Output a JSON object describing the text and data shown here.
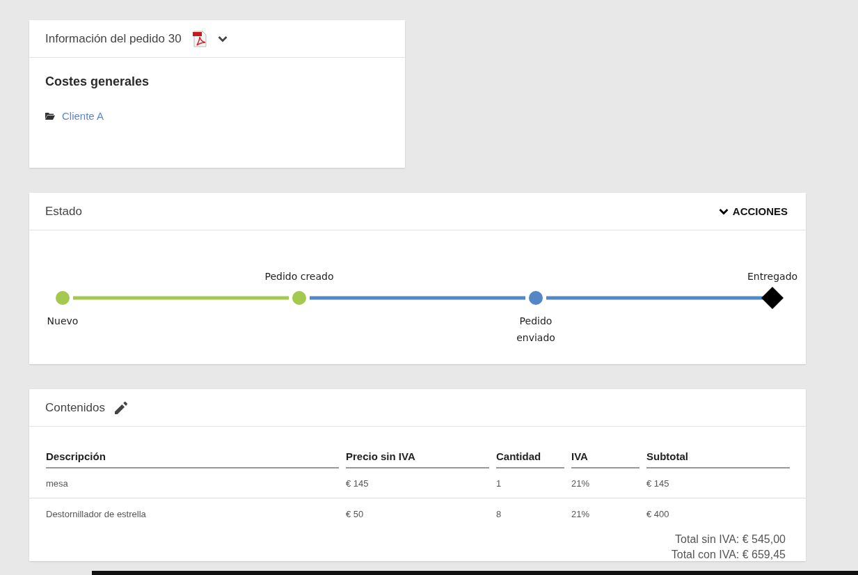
{
  "order_card": {
    "title": "Información del pedido 30",
    "section_title": "Costes generales",
    "client_link": "Cliente A"
  },
  "status_card": {
    "title": "Estado",
    "actions": "ACCIONES",
    "stages": [
      {
        "label": "Nuevo",
        "kind": "circle",
        "color": "#a4c94f"
      },
      {
        "label": "Pedido creado",
        "kind": "circle",
        "color": "#a4c94f"
      },
      {
        "label": "Pedido\nenviado",
        "kind": "circle",
        "color": "#5387c6"
      },
      {
        "label": "Entregado",
        "kind": "diamond",
        "color": "#000000"
      }
    ],
    "segments": [
      {
        "color": "#a4c94f"
      },
      {
        "color": "#5387c6"
      },
      {
        "color": "#5387c6"
      }
    ]
  },
  "contents_card": {
    "title": "Contenidos",
    "columns": [
      "Descripción",
      "Precio sin IVA",
      "Cantidad",
      "IVA",
      "Subtotal"
    ],
    "rows": [
      [
        "mesa",
        "€ 145",
        "1",
        "21%",
        "€ 145"
      ],
      [
        "Destornillador de estrella",
        "€ 50",
        "8",
        "21%",
        "€ 400"
      ]
    ],
    "totals": [
      "Total sin IVA: € 545,00",
      "Total con IVA: € 659,45"
    ]
  }
}
